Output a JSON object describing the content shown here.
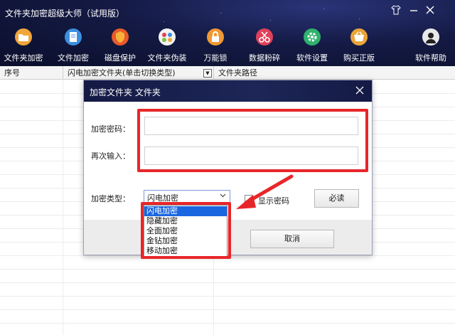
{
  "app": {
    "title": "文件夹加密超级大师（试用版）",
    "window_controls": [
      "shirt-icon",
      "minimize-icon",
      "close-icon"
    ]
  },
  "toolbar": {
    "items": [
      {
        "label": "文件夹加密",
        "icon": "folder-icon",
        "color": "#f0a63a"
      },
      {
        "label": "文件加密",
        "icon": "document-icon",
        "color": "#3b8fe0"
      },
      {
        "label": "磁盘保护",
        "icon": "shield-icon",
        "color": "#e85a2c"
      },
      {
        "label": "文件夹伪装",
        "icon": "disguise-icon",
        "color": "#7bc043"
      },
      {
        "label": "万能锁",
        "icon": "lock-icon",
        "color": "#f19933"
      },
      {
        "label": "数据粉碎",
        "icon": "shredder-icon",
        "color": "#e0415a"
      },
      {
        "label": "软件设置",
        "icon": "gear-icon",
        "color": "#2fb26c"
      },
      {
        "label": "购买正版",
        "icon": "cart-icon",
        "color": "#e9a53a"
      },
      {
        "label": "软件帮助",
        "icon": "help-user-icon",
        "color": "#dddddd"
      }
    ]
  },
  "table": {
    "columns": [
      "序号",
      "闪电加密文件夹(单击切换类型)",
      "文件夹路径"
    ]
  },
  "dialog": {
    "title": "加密文件夹 文件夹",
    "password_label": "加密密码：",
    "confirm_label": "再次输入：",
    "type_label": "加密类型：",
    "selected_type": "闪电加密",
    "type_options": [
      "闪电加密",
      "隐藏加密",
      "全面加密",
      "金钻加密",
      "移动加密"
    ],
    "show_password_label": "显示密码",
    "must_read_label": "必读",
    "cancel_label": "取消"
  },
  "colors": {
    "titlebar_dark": "#141a44",
    "annotation_red": "#e8262a",
    "selection_blue": "#1a66e0"
  }
}
